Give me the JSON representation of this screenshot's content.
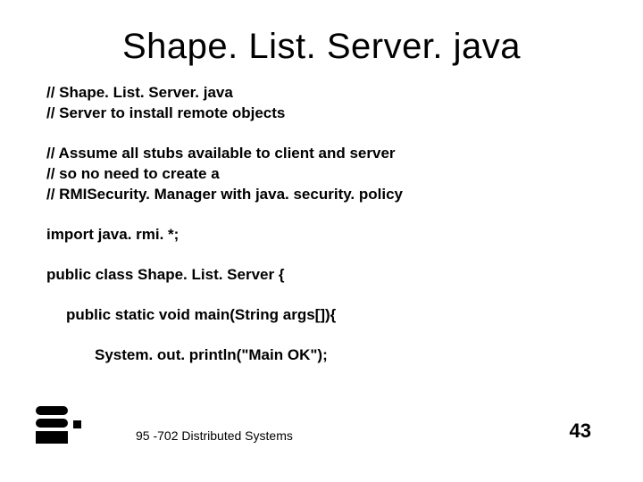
{
  "title": "Shape. List. Server. java",
  "code": {
    "c1": "// Shape. List. Server. java",
    "c2": "// Server to install remote objects",
    "c3": "// Assume all stubs available to client and server",
    "c4": "// so no need to create a",
    "c5": "// RMISecurity. Manager with java. security. policy",
    "c6": "import java. rmi. *;",
    "c7": "public class Shape. List. Server {",
    "c8": "public static void main(String args[]){",
    "c9": "System. out. println(\"Main OK\");"
  },
  "footer": {
    "course": "95 -702 Distributed Systems",
    "page": "43"
  }
}
